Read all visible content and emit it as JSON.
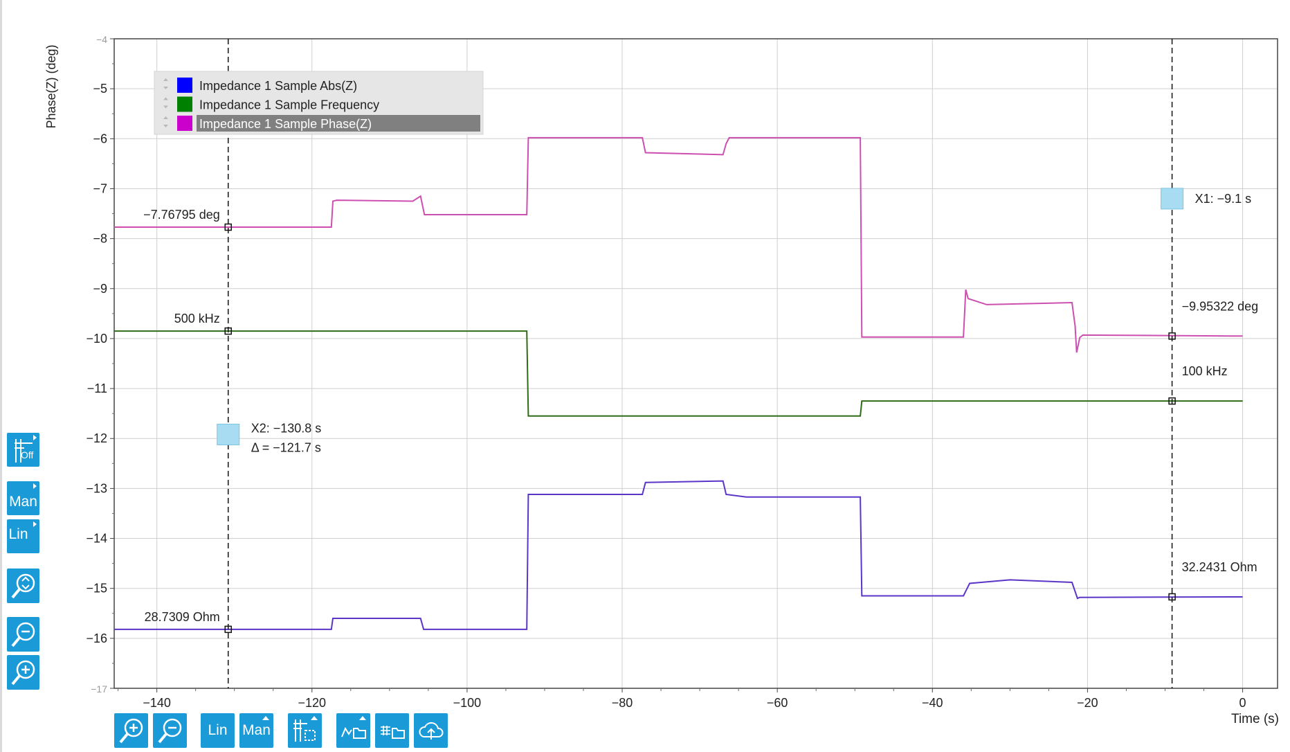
{
  "chart_data": {
    "type": "line",
    "xlabel": "Time (s)",
    "ylabel": "Phase(Z) (deg)",
    "xlim": [
      -145.5,
      4.5
    ],
    "ylim": [
      -17,
      -4
    ],
    "xticks": [
      -140,
      -120,
      -100,
      -80,
      -60,
      -40,
      -20,
      0
    ],
    "yticks": [
      -4,
      -5,
      -6,
      -7,
      -8,
      -9,
      -10,
      -11,
      -12,
      -13,
      -14,
      -15,
      -16,
      -17
    ],
    "grid": true,
    "legend_position": "top-left",
    "series": [
      {
        "name": "Impedance 1 Sample Abs(Z)",
        "color": "#0000ff",
        "line_color": "#5b35c8",
        "x": [
          -145.5,
          -117.5,
          -117.3,
          -106,
          -105.6,
          -92.3,
          -92.1,
          -77.4,
          -77,
          -67,
          -66.6,
          -64,
          -49.3,
          -49.1,
          -36,
          -35.2,
          -30,
          -22,
          -21.3,
          -21,
          0
        ],
        "y": [
          -15.82,
          -15.82,
          -15.6,
          -15.6,
          -15.82,
          -15.82,
          -13.12,
          -13.12,
          -12.88,
          -12.85,
          -13.12,
          -13.17,
          -13.17,
          -15.15,
          -15.15,
          -14.9,
          -14.83,
          -14.88,
          -15.2,
          -15.18,
          -15.17
        ]
      },
      {
        "name": "Impedance 1 Sample Frequency",
        "color": "#008000",
        "line_color": "#2e6b15",
        "x": [
          -145.5,
          -92.3,
          -92.1,
          -49.3,
          -49.1,
          0
        ],
        "y": [
          -9.85,
          -9.85,
          -11.55,
          -11.55,
          -11.25,
          -11.25
        ]
      },
      {
        "name": "Impedance 1 Sample Phase(Z)",
        "color": "#cc00cc",
        "line_color": "#cc4fb0",
        "x": [
          -145.5,
          -117.5,
          -117.3,
          -116.8,
          -107,
          -106,
          -105.5,
          -92.3,
          -92.1,
          -77.4,
          -77,
          -67,
          -66.6,
          -66.2,
          -49.3,
          -49.1,
          -36,
          -35.7,
          -35.4,
          -33,
          -22,
          -21.6,
          -21.4,
          -21,
          -20.6,
          0
        ],
        "y": [
          -7.77,
          -7.77,
          -7.25,
          -7.23,
          -7.25,
          -7.15,
          -7.52,
          -7.52,
          -5.98,
          -5.98,
          -6.28,
          -6.32,
          -6.1,
          -5.98,
          -5.98,
          -9.97,
          -9.97,
          -9.02,
          -9.2,
          -9.32,
          -9.28,
          -9.75,
          -10.28,
          -9.98,
          -9.93,
          -9.95
        ]
      }
    ],
    "cursors": {
      "x1": {
        "x": -9.1,
        "label": "X1: −9.1 s"
      },
      "x2": {
        "x": -130.8,
        "label": "X2: −130.8 s",
        "delta": "Δ = −121.7 s"
      }
    },
    "cursor_readouts": [
      {
        "text": "−7.76795 deg",
        "x": -130.8,
        "y": -7.77,
        "side": "left"
      },
      {
        "text": "500 kHz",
        "x": -130.8,
        "y": -9.85,
        "side": "left"
      },
      {
        "text": "28.7309 Ohm",
        "x": -130.8,
        "y": -15.82,
        "side": "left"
      },
      {
        "text": "−9.95322 deg",
        "x": -9.1,
        "y": -9.95,
        "side": "right"
      },
      {
        "text": "100 kHz",
        "x": -9.1,
        "y": -11.25,
        "side": "right"
      },
      {
        "text": "32.2431 Ohm",
        "x": -9.1,
        "y": -15.17,
        "side": "right"
      }
    ]
  },
  "controls": {
    "side": {
      "grid_label": "Off",
      "range_label": "Man",
      "scale_label": "Lin"
    },
    "bottom": {
      "scale_label": "Lin",
      "range_label": "Man"
    }
  }
}
